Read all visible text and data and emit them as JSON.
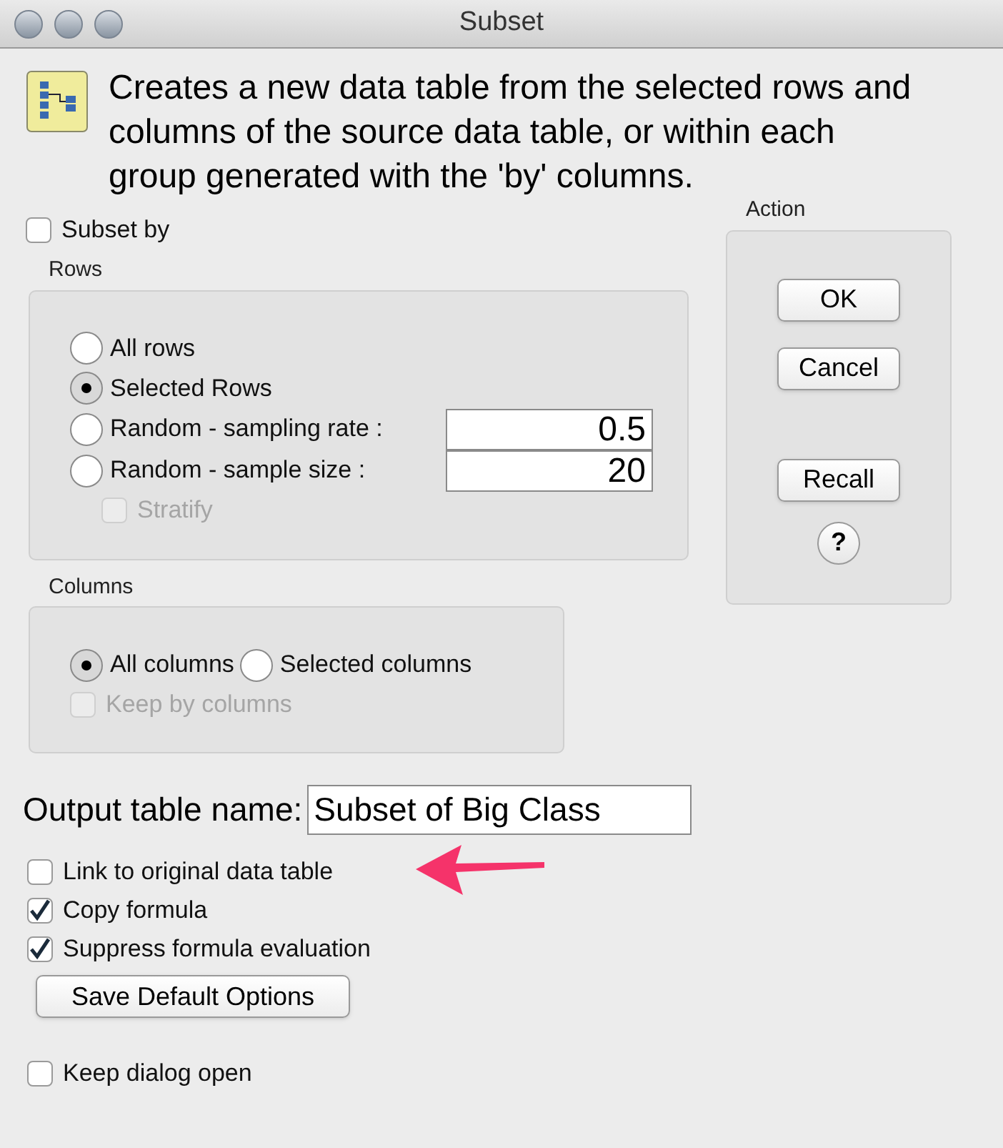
{
  "window": {
    "title": "Subset"
  },
  "description": "Creates a new data table from the selected rows and columns of the source data table, or within each group generated with the 'by' columns.",
  "subset_by": {
    "label": "Subset by",
    "checked": false
  },
  "rows": {
    "title": "Rows",
    "options": [
      {
        "label": "All rows",
        "selected": false
      },
      {
        "label": "Selected Rows",
        "selected": true
      },
      {
        "label": "Random - sampling rate :",
        "selected": false,
        "value": "0.5"
      },
      {
        "label": "Random - sample size :",
        "selected": false,
        "value": "20"
      }
    ],
    "stratify": {
      "label": "Stratify",
      "checked": false,
      "disabled": true
    }
  },
  "columns": {
    "title": "Columns",
    "options": [
      {
        "label": "All columns",
        "selected": true
      },
      {
        "label": "Selected columns",
        "selected": false
      }
    ],
    "keep_by": {
      "label": "Keep by columns",
      "checked": false,
      "disabled": true
    }
  },
  "output": {
    "label": "Output table name:",
    "value": "Subset of Big Class"
  },
  "options": [
    {
      "label": "Link to original data table",
      "checked": false
    },
    {
      "label": "Copy formula",
      "checked": true
    },
    {
      "label": "Suppress formula evaluation",
      "checked": true
    }
  ],
  "save_button": "Save Default Options",
  "keep_open": {
    "label": "Keep dialog open",
    "checked": false
  },
  "action": {
    "title": "Action",
    "buttons": [
      "OK",
      "Cancel",
      "Recall"
    ],
    "help": "?"
  }
}
